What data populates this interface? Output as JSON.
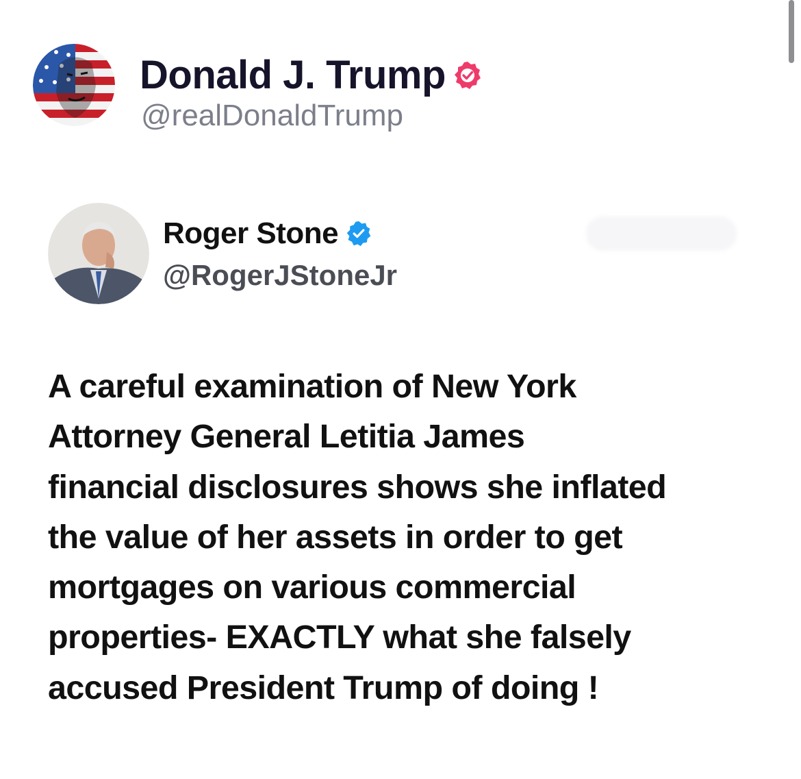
{
  "post": {
    "author": {
      "name": "Donald J. Trump",
      "handle": "@realDonaldTrump",
      "verified": true,
      "badge_color": "#ee3b6a"
    },
    "quoted": {
      "author": {
        "name": "Roger Stone",
        "handle": "@RogerJStoneJr",
        "verified": true,
        "badge_color": "#1d9bf0"
      },
      "text_lines": [
        "A careful examination of New York",
        "Attorney General Letitia James",
        "financial disclosures shows she inflated",
        "the value of her assets in order to get",
        "mortgages on various commercial",
        "properties- EXACTLY what she falsely",
        "accused President Trump of doing !"
      ]
    }
  },
  "icons": {
    "trump_badge": "verified-badge-icon",
    "stone_badge": "verified-badge-icon"
  }
}
